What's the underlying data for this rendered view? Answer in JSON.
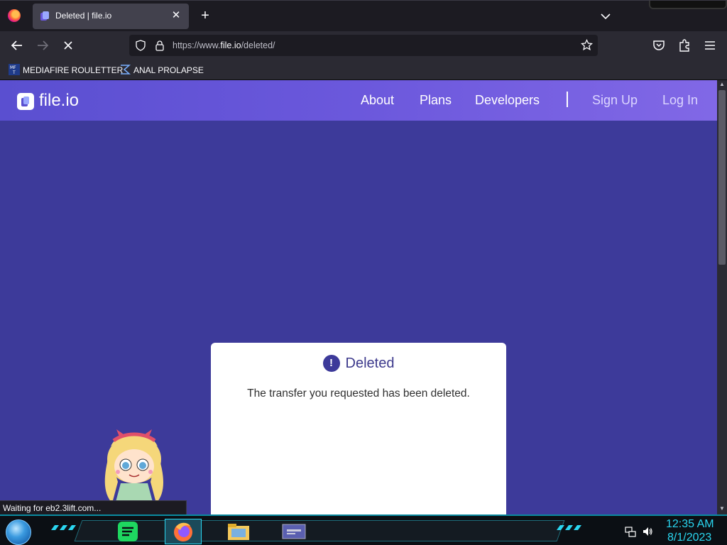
{
  "browser": {
    "tab_title": "Deleted | file.io",
    "url_prefix": "https://www.",
    "url_domain": "file.io",
    "url_path": "/deleted/",
    "status_text": "Waiting for eb2.3lift.com...",
    "bookmarks": [
      {
        "label": "MEDIAFIRE ROULETTER",
        "icon": "mediafire-icon"
      },
      {
        "label": "ANAL PROLAPSE",
        "icon": "sigma-icon"
      }
    ]
  },
  "site": {
    "logo_text": "file.io",
    "nav": {
      "about": "About",
      "plans": "Plans",
      "developers": "Developers",
      "signup": "Sign Up",
      "login": "Log In"
    },
    "card": {
      "icon": "!",
      "title": "Deleted",
      "message": "The transfer you requested has been deleted."
    },
    "colors": {
      "page_bg": "#3d3a9a",
      "header_gradient_start": "#5a4fd0",
      "header_gradient_end": "#8168e6",
      "accent_cyan": "#2ad6f0"
    }
  },
  "taskbar": {
    "time": "12:35 AM",
    "date": "8/1/2023",
    "apps": [
      "spotify-icon",
      "firefox-icon",
      "file-explorer-icon",
      "window-icon"
    ]
  }
}
